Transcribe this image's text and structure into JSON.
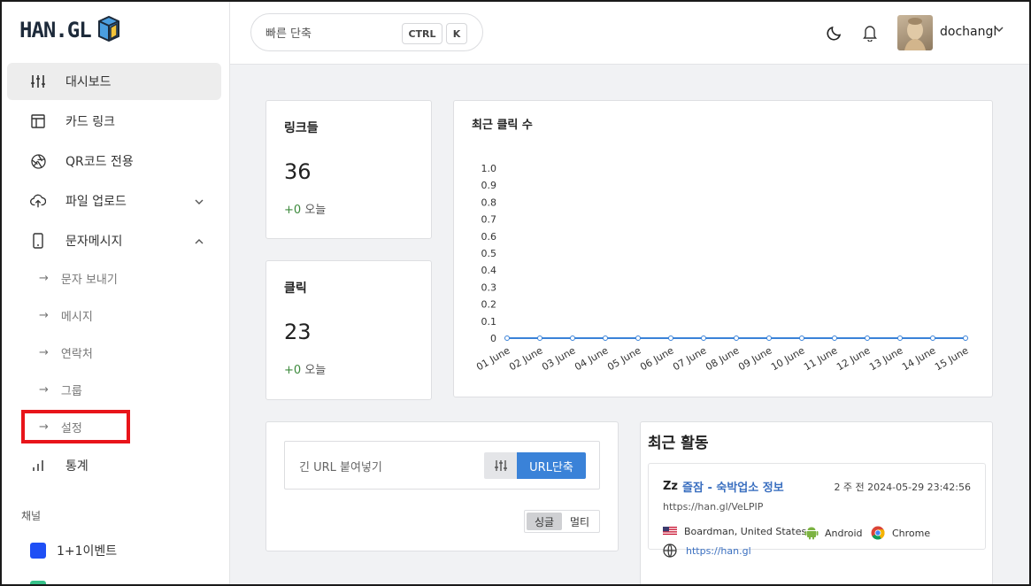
{
  "brand": {
    "logo_text": "HAN.GL"
  },
  "sidebar": {
    "items": [
      {
        "label": "대시보드"
      },
      {
        "label": "카드 링크"
      },
      {
        "label": "QR코드 전용"
      },
      {
        "label": "파일 업로드"
      },
      {
        "label": "문자메시지"
      }
    ],
    "sub_items": [
      {
        "arrow": "→",
        "label": "문자 보내기"
      },
      {
        "arrow": "→",
        "label": "메시지"
      },
      {
        "arrow": "→",
        "label": "연락처"
      },
      {
        "arrow": "→",
        "label": "그룹"
      },
      {
        "arrow": "→",
        "label": "설정"
      }
    ],
    "stats": {
      "label": "통계"
    },
    "channels_label": "채널",
    "channels": [
      {
        "label": "1+1이벤트",
        "color": "#1f4ff5"
      }
    ]
  },
  "topbar": {
    "search_placeholder": "빠른 단축",
    "kbd_ctrl": "CTRL",
    "kbd_k": "K",
    "username": "dochangl"
  },
  "stats": {
    "links": {
      "title": "링크들",
      "value": "36",
      "delta": "+0",
      "delta_label": "오늘"
    },
    "clicks": {
      "title": "클릭",
      "value": "23",
      "delta": "+0",
      "delta_label": "오늘"
    }
  },
  "chart_data": {
    "type": "line",
    "title": "최근 클릭 수",
    "categories": [
      "01 June",
      "02 June",
      "03 June",
      "04 June",
      "05 June",
      "06 June",
      "07 June",
      "08 June",
      "09 June",
      "10 June",
      "11 June",
      "12 June",
      "13 June",
      "14 June",
      "15 June"
    ],
    "series": [
      {
        "values": [
          0,
          0,
          0,
          0,
          0,
          0,
          0,
          0,
          0,
          0,
          0,
          0,
          0,
          0,
          0
        ]
      }
    ],
    "yticks": [
      "1.0",
      "0.9",
      "0.8",
      "0.7",
      "0.6",
      "0.5",
      "0.4",
      "0.3",
      "0.2",
      "0.1",
      "0"
    ],
    "ylim": [
      0,
      1
    ],
    "grid": false,
    "line_color": "#3a82d8"
  },
  "shortener": {
    "placeholder": "긴 URL 붙여넣기",
    "submit_label": "URL단축",
    "mode_single": "싱글",
    "mode_multi": "멀티"
  },
  "activity": {
    "title": "최근 활동",
    "item": {
      "icon_text": "Zz",
      "title": "즐잠 - 숙박업소 정보",
      "time": "2 주 전 2024-05-29 23:42:56",
      "short_url": "https://han.gl/VeLPIP",
      "location": "Boardman, United States",
      "os": "Android",
      "browser": "Chrome",
      "destination": "https://han.gl"
    }
  }
}
